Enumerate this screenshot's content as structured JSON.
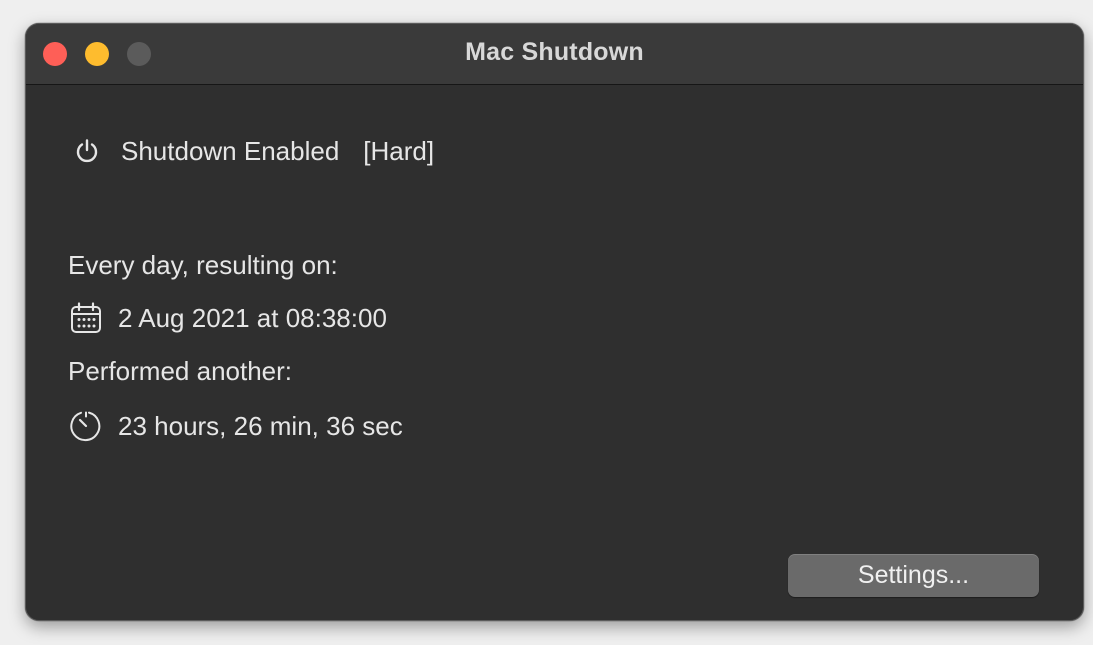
{
  "window": {
    "title": "Mac Shutdown"
  },
  "status": {
    "icon": "power-icon",
    "label": "Shutdown Enabled",
    "mode": "[Hard]"
  },
  "schedule": {
    "label": "Every day, resulting on:",
    "date_icon": "calendar-icon",
    "date_value": "2 Aug 2021 at 08:38:00"
  },
  "countdown": {
    "label": "Performed another:",
    "timer_icon": "timer-icon",
    "remaining": "23 hours, 26 min, 36 sec"
  },
  "actions": {
    "settings_label": "Settings..."
  },
  "colors": {
    "close": "#fe5f57",
    "minimize": "#febc2e",
    "zoom_disabled": "#5b5b5b",
    "window_bg": "#2f2f2f",
    "titlebar_bg": "#3a3a3a",
    "button_bg": "#6a6a6a"
  }
}
